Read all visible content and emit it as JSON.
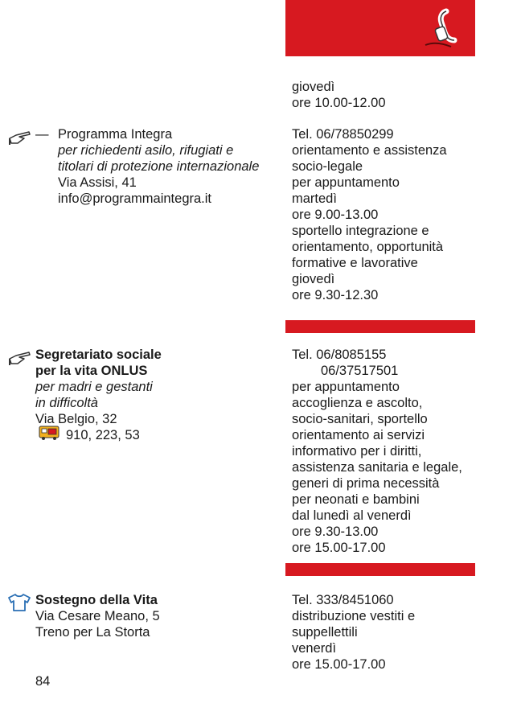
{
  "top_block": {
    "lines": [
      "giovedì",
      "ore 10.00-12.00"
    ]
  },
  "entries": [
    {
      "dash": "—",
      "name": "Programma Integra",
      "desc": [
        "per richiedenti asilo, rifugiati e",
        "titolari di protezione internazionale"
      ],
      "address": "Via Assisi, 41",
      "email": "info@programmaintegra.it",
      "details": [
        "Tel. 06/78850299",
        "orientamento e assistenza",
        "socio-legale",
        "per appuntamento",
        "martedì",
        "ore 9.00-13.00",
        "sportello integrazione e",
        "orientamento, opportunità",
        "formative e lavorative",
        "giovedì",
        "ore 9.30-12.30"
      ],
      "icon": "pointing-hand-icon"
    },
    {
      "name_lines": [
        "Segretariato sociale",
        "per la vita ONLUS"
      ],
      "desc": [
        "per madri e gestanti",
        "in difficoltà"
      ],
      "address": "Via Belgio, 32",
      "bus": "910, 223, 53",
      "tel_first": "Tel. 06/8085155",
      "tel_second": "06/37517501",
      "details": [
        "per appuntamento",
        "accoglienza e ascolto,",
        "socio-sanitari, sportello",
        "orientamento ai servizi",
        "informativo per i diritti,",
        "assistenza sanitaria e legale,",
        "generi di prima necessità",
        "per neonati e bambini",
        "dal lunedì al venerdì",
        "ore 9.30-13.00",
        "ore 15.00-17.00"
      ],
      "icon": "pointing-hand-icon",
      "bus_icon": "bus-icon"
    },
    {
      "name": "Sostegno della Vita",
      "address_lines": [
        "Via Cesare Meano, 5",
        "Treno per La Storta"
      ],
      "details": [
        "Tel. 333/8451060",
        "distribuzione vestiti e",
        "suppellettili",
        "venerdì",
        "ore 15.00-17.00"
      ],
      "icon": "tshirt-icon"
    }
  ],
  "page_number": "84",
  "colors": {
    "accent_red": "#d71920",
    "text": "#1a1a1a"
  },
  "header_icon": "telephone-icon"
}
